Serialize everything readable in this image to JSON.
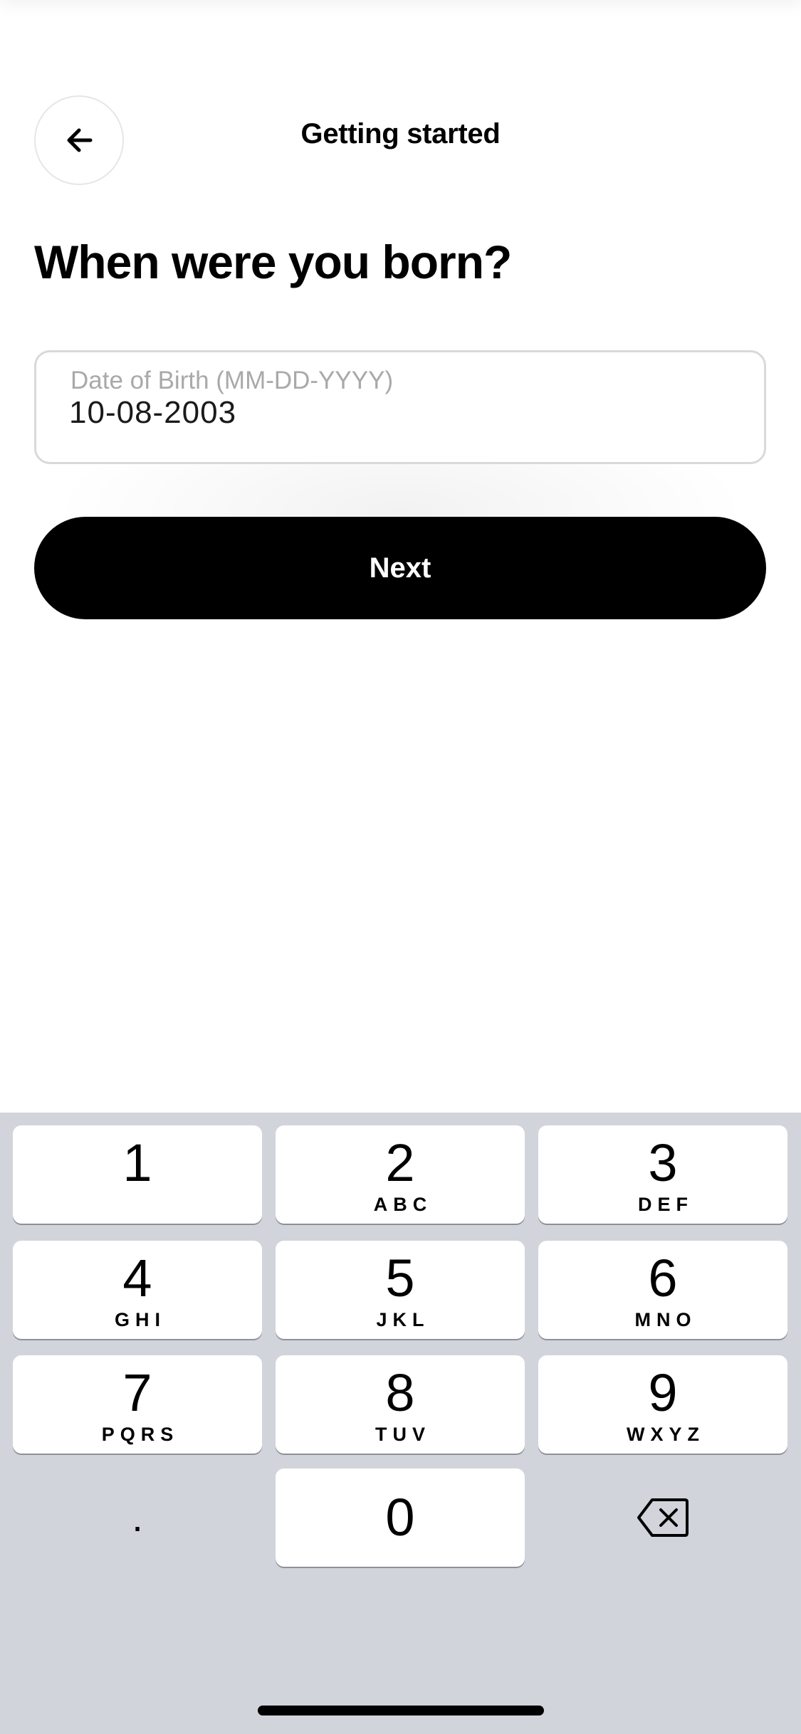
{
  "header": {
    "title": "Getting started",
    "back_icon": "arrow-left-icon"
  },
  "question": "When were you born?",
  "dob_field": {
    "label": "Date of Birth (MM-DD-YYYY)",
    "value": "10-08-2003"
  },
  "next_button": {
    "label": "Next"
  },
  "keyboard": {
    "keys": [
      {
        "digit": "1",
        "letters": ""
      },
      {
        "digit": "2",
        "letters": "ABC"
      },
      {
        "digit": "3",
        "letters": "DEF"
      },
      {
        "digit": "4",
        "letters": "GHI"
      },
      {
        "digit": "5",
        "letters": "JKL"
      },
      {
        "digit": "6",
        "letters": "MNO"
      },
      {
        "digit": "7",
        "letters": "PQRS"
      },
      {
        "digit": "8",
        "letters": "TUV"
      },
      {
        "digit": "9",
        "letters": "WXYZ"
      },
      {
        "digit": "0",
        "letters": ""
      }
    ],
    "decimal_label": ".",
    "delete_icon": "delete-backspace-icon"
  },
  "colors": {
    "background": "#ffffff",
    "button": "#000000",
    "keyboard": "#d1d4db",
    "placeholder": "#a9a9a9"
  }
}
